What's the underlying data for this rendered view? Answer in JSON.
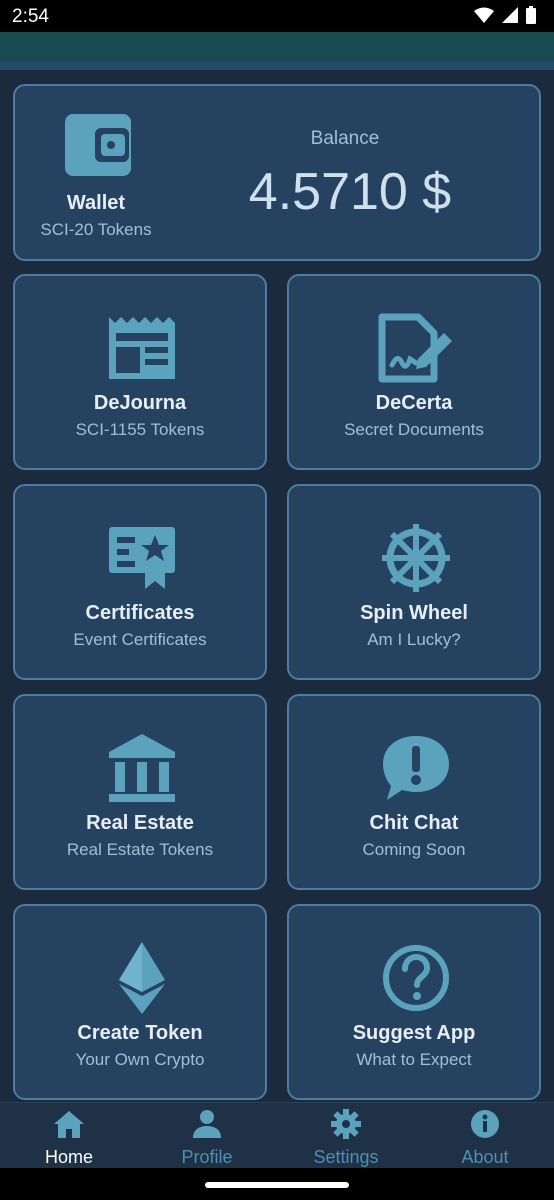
{
  "status_bar": {
    "time": "2:54"
  },
  "wallet": {
    "title": "Wallet",
    "subtitle": "SCI-20 Tokens",
    "balance_label": "Balance",
    "balance_value": "4.5710 $",
    "icon": "wallet-icon"
  },
  "tiles": [
    {
      "title": "DeJourna",
      "subtitle": "SCI-1155 Tokens",
      "icon": "newspaper-icon"
    },
    {
      "title": "DeCerta",
      "subtitle": "Secret Documents",
      "icon": "signature-document-icon"
    },
    {
      "title": "Certificates",
      "subtitle": "Event Certificates",
      "icon": "certificate-icon"
    },
    {
      "title": "Spin Wheel",
      "subtitle": "Am I Lucky?",
      "icon": "wheel-icon"
    },
    {
      "title": "Real Estate",
      "subtitle": "Real Estate Tokens",
      "icon": "bank-building-icon"
    },
    {
      "title": "Chit Chat",
      "subtitle": "Coming Soon",
      "icon": "chat-alert-icon"
    },
    {
      "title": "Create Token",
      "subtitle": "Your Own Crypto",
      "icon": "ethereum-icon"
    },
    {
      "title": "Suggest App",
      "subtitle": "What to Expect",
      "icon": "question-circle-icon"
    }
  ],
  "bottom_nav": [
    {
      "label": "Home",
      "icon": "home-icon",
      "active": true
    },
    {
      "label": "Profile",
      "icon": "person-icon",
      "active": false
    },
    {
      "label": "Settings",
      "icon": "gear-icon",
      "active": false
    },
    {
      "label": "About",
      "icon": "info-icon",
      "active": false
    }
  ],
  "colors": {
    "background": "#1b2a3c",
    "card": "#264261",
    "card_border": "#4b7e9c",
    "icon": "#5ba3bd",
    "active_nav": "#ffffff",
    "inactive_nav": "#4f8fb0"
  }
}
